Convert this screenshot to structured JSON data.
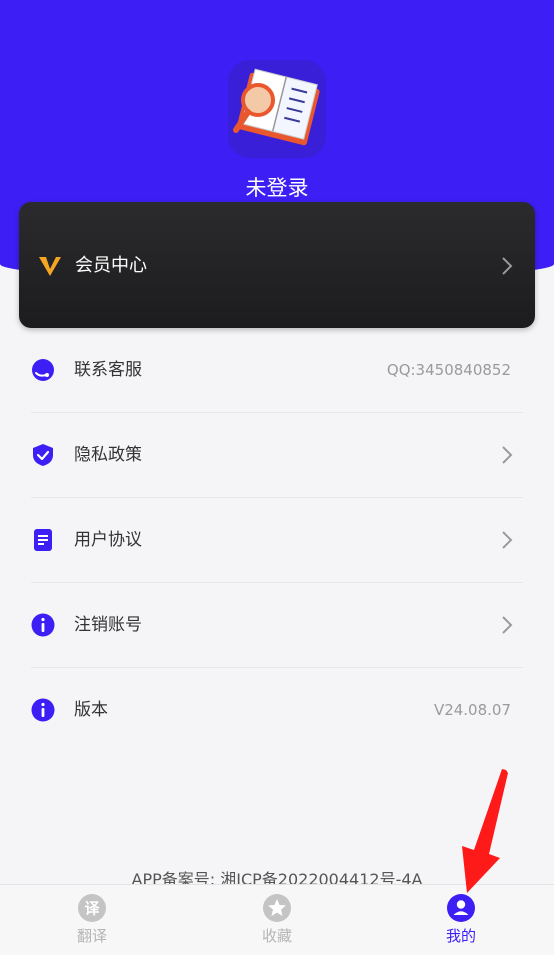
{
  "profile": {
    "username": "未登录"
  },
  "vip": {
    "label": "会员中心"
  },
  "menu": [
    {
      "label": "联系客服",
      "value": "QQ:3450840852",
      "icon": "headset-icon"
    },
    {
      "label": "隐私政策",
      "icon": "shield-check-icon"
    },
    {
      "label": "用户协议",
      "icon": "document-icon"
    },
    {
      "label": "注销账号",
      "icon": "info-icon"
    },
    {
      "label": "版本",
      "value": "V24.08.07",
      "icon": "info-icon"
    }
  ],
  "footer": {
    "icp": "APP备案号: 湘ICP备2022004412号-4A"
  },
  "tabs": [
    {
      "label": "翻译",
      "glyph": "译",
      "icon": "translate-icon"
    },
    {
      "label": "收藏",
      "icon": "star-icon"
    },
    {
      "label": "我的",
      "icon": "person-icon",
      "active": true
    }
  ],
  "colors": {
    "brand": "#3d1ef5",
    "vip_accent": "#f5a623",
    "annotation_arrow": "#ff1a1a"
  }
}
